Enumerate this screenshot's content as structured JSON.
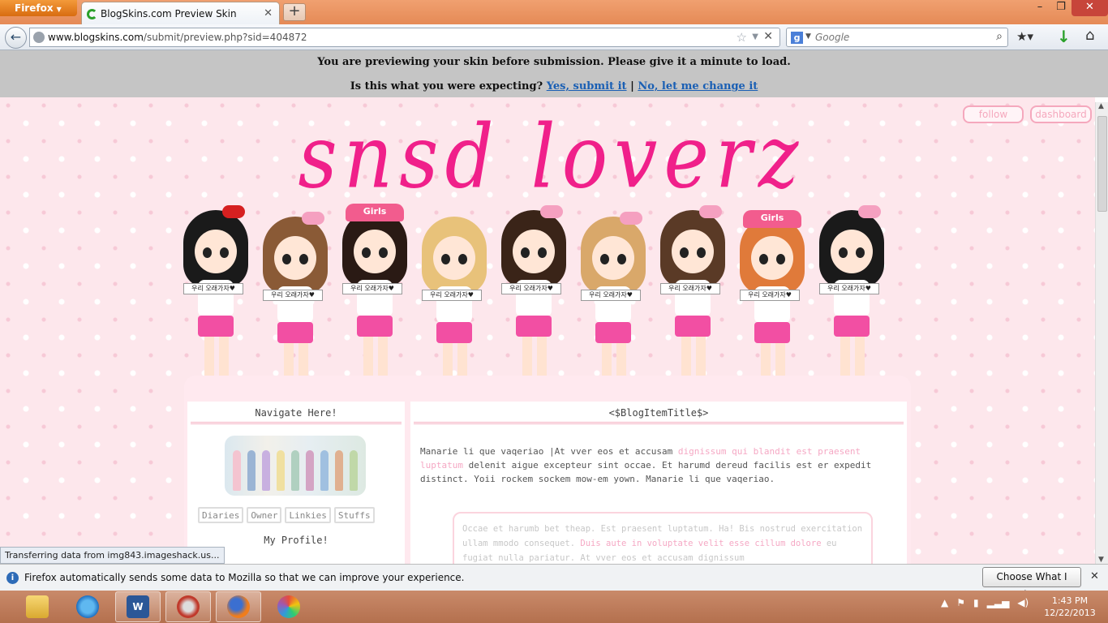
{
  "browser": {
    "menu_label": "Firefox",
    "tab_title": "BlogSkins.com Preview Skin",
    "url_domain": "www.blogskins.com",
    "url_path": "/submit/preview.php?sid=404872",
    "search_engine": "Google",
    "search_placeholder": "Google"
  },
  "banner": {
    "line1": "You are previewing your skin before submission. Please give it a minute to load.",
    "question": "Is this what you were expecting?",
    "yes_link": "Yes, submit it",
    "separator": "|",
    "no_link": "No, let me change it"
  },
  "blog": {
    "title": "snsd loverz",
    "follow_label": "follow",
    "dashboard_label": "dashboard",
    "sign_text": "우리 오래가자♥",
    "hat_text": "Girls",
    "sidebar": {
      "heading": "Navigate Here!",
      "tabs": [
        "Diaries",
        "Owner",
        "Linkies",
        "Stuffs"
      ],
      "profile_heading": "My Profile!"
    },
    "post": {
      "title": "<$BlogItemTitle$>",
      "para_start": "Manarie li que vaqeriao |At vver eos et accusam ",
      "para_link": "dignissum qui blandit est praesent luptatum",
      "para_end": " delenit aigue excepteur sint occae. Et harumd dereud facilis est er expedit distinct. Yoii rockem sockem mow-em yown. Manarie li que vaqeriao.",
      "quote_start": "Occae et harumb bet theap. Est praesent luptatum. Ha! Bis nostrud exercitation ullam mmodo consequet. ",
      "quote_link": "Duis aute in voluptate velit esse cillum dolore",
      "quote_end": " eu fugiat nulla pariatur. At vver eos et accusam dignissum"
    }
  },
  "status_tip": "Transferring data from img843.imageshack.us...",
  "notification": {
    "text": "Firefox automatically sends some data to Mozilla so that we can improve your experience.",
    "button": "Choose What I Share"
  },
  "taskbar": {
    "time": "1:43 PM",
    "date": "12/22/2013"
  },
  "colors": {
    "accent_pink": "#f0208a",
    "soft_pink": "#f5a8c4",
    "link_blue": "#1a5fb4"
  }
}
